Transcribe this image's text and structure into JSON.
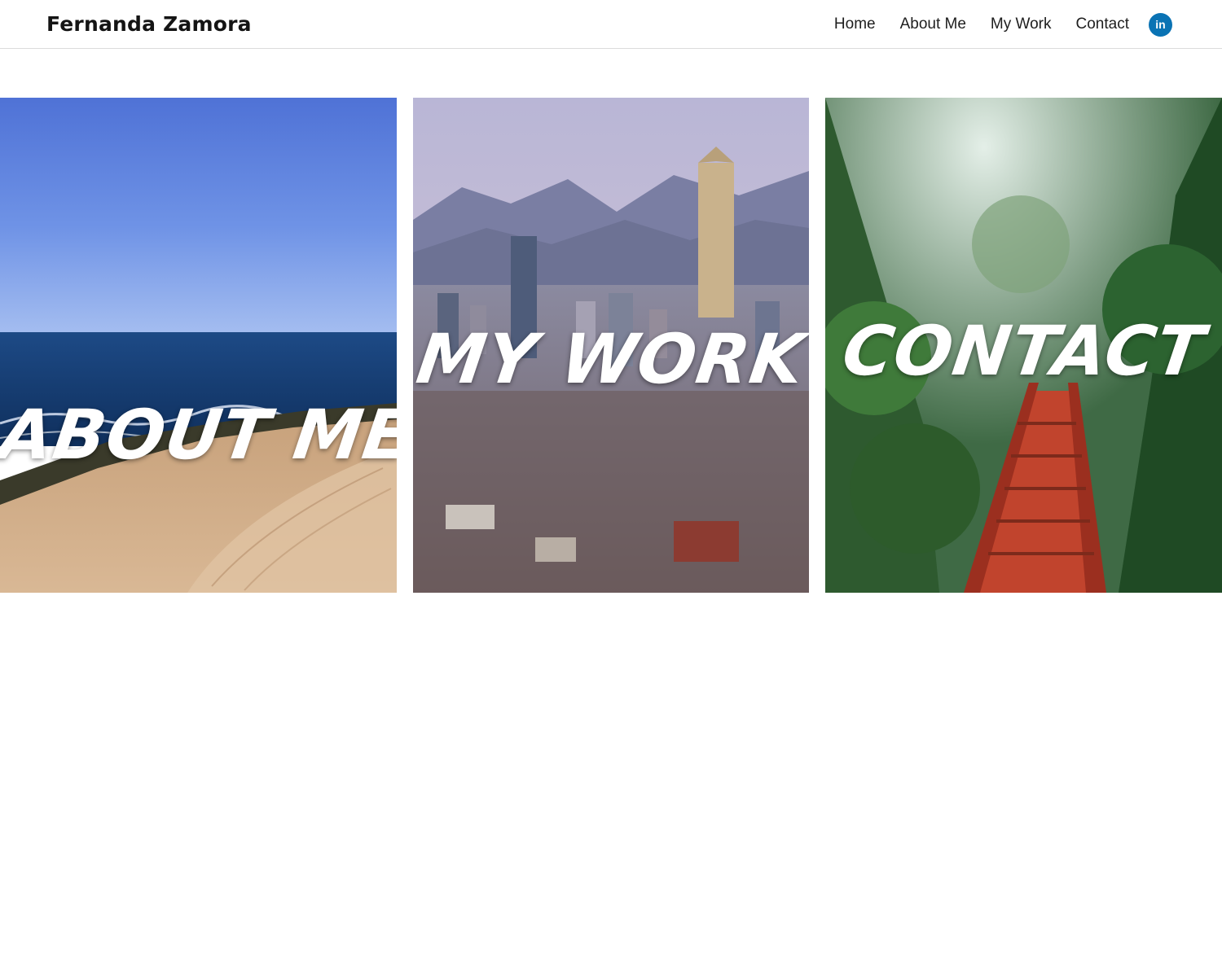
{
  "header": {
    "site_title": "Fernanda Zamora",
    "nav": [
      {
        "label": "Home"
      },
      {
        "label": "About Me"
      },
      {
        "label": "My Work"
      },
      {
        "label": "Contact"
      }
    ],
    "social": {
      "icon": "linkedin-icon",
      "glyph": "in",
      "color": "#0a73b4"
    }
  },
  "tiles": [
    {
      "label": "ABOUT ME",
      "scene": "coastal sand dune with ocean"
    },
    {
      "label": "MY WORK",
      "scene": "city skyline with mountains"
    },
    {
      "label": "CONTACT",
      "scene": "red wooden bridge in forest"
    }
  ]
}
